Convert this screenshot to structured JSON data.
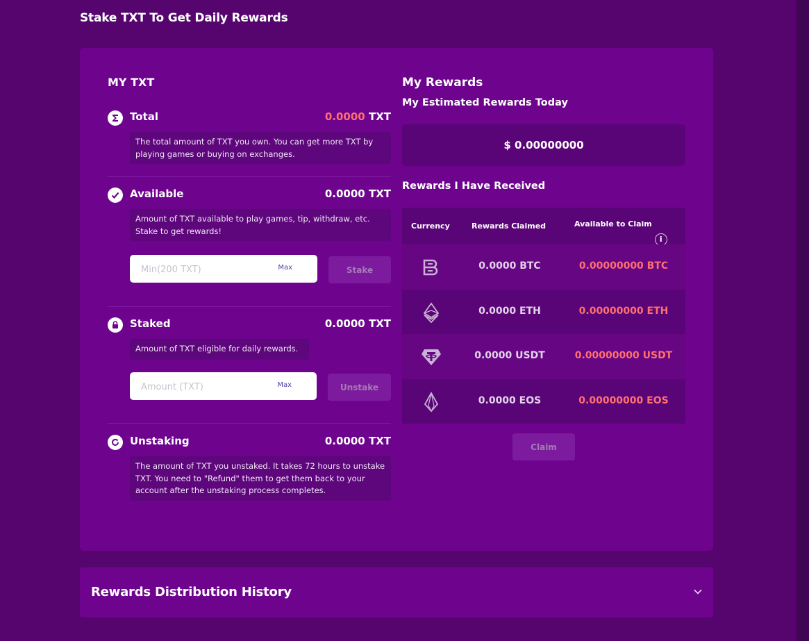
{
  "page_title": "Stake TXT To Get Daily Rewards",
  "my_txt": {
    "heading": "MY TXT",
    "rows": [
      {
        "label": "Total",
        "value": "0.0000",
        "unit": "TXT",
        "desc": "The total amount of TXT you own. You can get more TXT by playing games or buying on exchanges.",
        "icon": "sigma-icon"
      },
      {
        "label": "Available",
        "value": "0.0000",
        "unit": "TXT",
        "desc": "Amount of TXT available to play games, tip, withdraw, etc. Stake to get rewards!",
        "icon": "check-icon"
      },
      {
        "label": "Staked",
        "value": "0.0000",
        "unit": "TXT",
        "desc": "Amount of TXT eligible for daily rewards.",
        "icon": "lock-icon"
      },
      {
        "label": "Unstaking",
        "value": "0.0000",
        "unit": "TXT",
        "desc": "The amount of TXT you unstaked. It takes 72 hours to unstake TXT. You need to \"Refund\" them to get them back to your account after the unstaking process completes.",
        "icon": "refresh-icon"
      }
    ],
    "stake_input": {
      "placeholder": "Min(200 TXT)",
      "max_label": "Max",
      "button": "Stake"
    },
    "unstake_input": {
      "placeholder": "Amount (TXT)",
      "max_label": "Max",
      "button": "Unstake"
    }
  },
  "rewards": {
    "heading": "My Rewards",
    "estimated_heading": "My Estimated Rewards Today",
    "estimated_value": "$ 0.00000000",
    "received_heading": "Rewards I Have Received",
    "columns": [
      "Currency",
      "Rewards Claimed",
      "Available to Claim"
    ],
    "rows": [
      {
        "icon": "btc-icon",
        "claimed": "0.0000 BTC",
        "available": "0.00000000 BTC"
      },
      {
        "icon": "eth-icon",
        "claimed": "0.0000 ETH",
        "available": "0.00000000 ETH"
      },
      {
        "icon": "usdt-icon",
        "claimed": "0.0000 USDT",
        "available": "0.00000000 USDT"
      },
      {
        "icon": "eos-icon",
        "claimed": "0.0000 EOS",
        "available": "0.00000000 EOS"
      }
    ],
    "claim_button": "Claim"
  },
  "history": {
    "title": "Rewards Distribution History"
  },
  "colors": {
    "bg": "#56056e",
    "card": "#6e048e",
    "accent": "#ff6f6f"
  }
}
